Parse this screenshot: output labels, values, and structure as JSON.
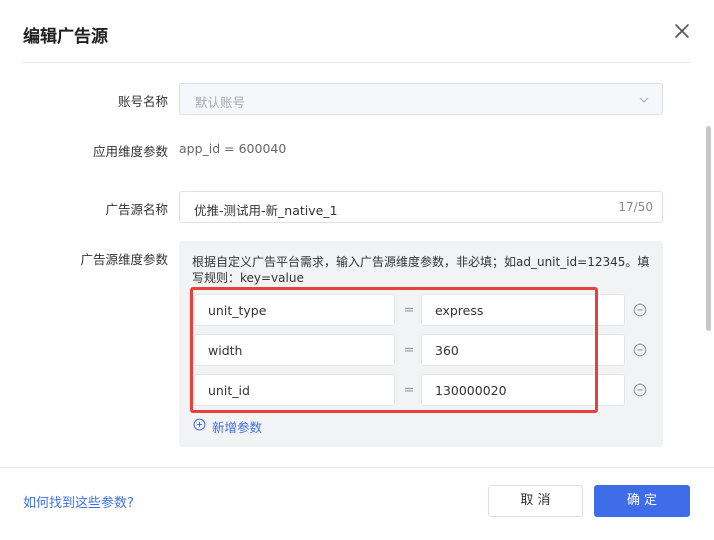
{
  "dialog": {
    "title": "编辑广告源",
    "close_icon": "close-icon"
  },
  "form": {
    "account_label": "账号名称",
    "account_placeholder": "默认账号",
    "app_param_label": "应用维度参数",
    "app_param_value": "app_id = 600040",
    "source_name_label": "广告源名称",
    "source_name_value": "优推-测试用-新_native_1",
    "source_name_count": "17/50",
    "source_param_label": "广告源维度参数",
    "source_param_hint": "根据自定义广告平台需求，输入广告源维度参数，非必填；如ad_unit_id=12345。填写规则：key=value",
    "params": [
      {
        "key": "unit_type",
        "eq": "=",
        "value": "express"
      },
      {
        "key": "width",
        "eq": "=",
        "value": "360"
      },
      {
        "key": "unit_id",
        "eq": "=",
        "value": "130000020"
      }
    ],
    "add_param_label": "新增参数"
  },
  "footer": {
    "help_link": "如何找到这些参数?",
    "cancel_label": "取 消",
    "ok_label": "确 定"
  },
  "colors": {
    "accent": "#3f6ce8",
    "highlight": "#e8403d"
  }
}
